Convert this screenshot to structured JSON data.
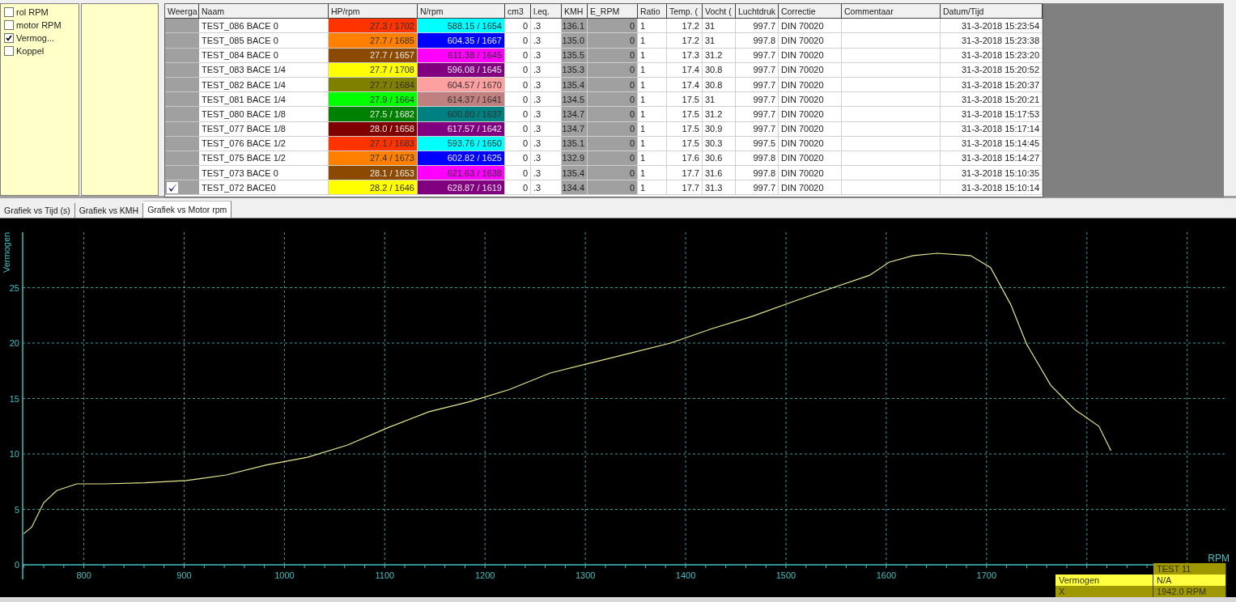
{
  "channels": [
    {
      "label": "rol RPM",
      "checked": false
    },
    {
      "label": "motor RPM",
      "checked": false
    },
    {
      "label": "Vermog...",
      "checked": true
    },
    {
      "label": "Koppel",
      "checked": false
    }
  ],
  "table": {
    "columns": [
      "Weerga",
      "Naam",
      "HP/rpm",
      "N/rpm",
      "cm3",
      "l.eq.",
      "KMH",
      "E_RPM",
      "Ratio",
      "Temp. (",
      "Vocht (",
      "Luchtdruk",
      "Correctie",
      "Commentaar",
      "Datum/Tijd"
    ],
    "rows": [
      {
        "shown": false,
        "name": "TEST_086 BACE 0",
        "hp": {
          "text": "27.3 / 1702",
          "color": "#ff3300"
        },
        "n": {
          "text": "588.15 / 1654",
          "color": "#00ffff"
        },
        "cm3": "0",
        "leq": ".3",
        "kmh": "136.1",
        "e_rpm": "0",
        "ratio": "1",
        "temp": "17.2",
        "vocht": "31",
        "luchtdruk": "997.7",
        "correctie": "DIN 70020",
        "datum": "31-3-2018 15:23:54"
      },
      {
        "shown": false,
        "name": "TEST_085 BACE 0",
        "hp": {
          "text": "27.7 / 1685",
          "color": "#ff8000"
        },
        "n": {
          "text": "604.35 / 1667",
          "color": "#0000ff"
        },
        "cm3": "0",
        "leq": ".3",
        "kmh": "135.0",
        "e_rpm": "0",
        "ratio": "1",
        "temp": "17.2",
        "vocht": "31",
        "luchtdruk": "997.8",
        "correctie": "DIN 70020",
        "datum": "31-3-2018 15:23:38"
      },
      {
        "shown": false,
        "name": "TEST_084 BACE 0",
        "hp": {
          "text": "27.7 / 1657",
          "color": "#8b4a00"
        },
        "n": {
          "text": "611.38 / 1645",
          "color": "#ff00ff"
        },
        "cm3": "0",
        "leq": ".3",
        "kmh": "135.5",
        "e_rpm": "0",
        "ratio": "1",
        "temp": "17.3",
        "vocht": "31.2",
        "luchtdruk": "997.7",
        "correctie": "DIN 70020",
        "datum": "31-3-2018 15:23:20"
      },
      {
        "shown": false,
        "name": "TEST_083 BACE 1/4",
        "hp": {
          "text": "27.7 / 1708",
          "color": "#ffff00"
        },
        "n": {
          "text": "596.08 / 1645",
          "color": "#800080"
        },
        "cm3": "0",
        "leq": ".3",
        "kmh": "135.3",
        "e_rpm": "0",
        "ratio": "1",
        "temp": "17.4",
        "vocht": "30.8",
        "luchtdruk": "997.7",
        "correctie": "DIN 70020",
        "datum": "31-3-2018 15:20:52"
      },
      {
        "shown": false,
        "name": "TEST_082 BACE 1/4",
        "hp": {
          "text": "27.7 / 1684",
          "color": "#808000"
        },
        "n": {
          "text": "604.57 / 1670",
          "color": "#ffa0a0"
        },
        "cm3": "0",
        "leq": ".3",
        "kmh": "135.4",
        "e_rpm": "0",
        "ratio": "1",
        "temp": "17.4",
        "vocht": "30.8",
        "luchtdruk": "997.7",
        "correctie": "DIN 70020",
        "datum": "31-3-2018 15:20:37"
      },
      {
        "shown": false,
        "name": "TEST_081 BACE 1/4",
        "hp": {
          "text": "27.9 / 1664",
          "color": "#00ff00"
        },
        "n": {
          "text": "614.37 / 1641",
          "color": "#c08080"
        },
        "cm3": "0",
        "leq": ".3",
        "kmh": "134.5",
        "e_rpm": "0",
        "ratio": "1",
        "temp": "17.5",
        "vocht": "31",
        "luchtdruk": "997.7",
        "correctie": "DIN 70020",
        "datum": "31-3-2018 15:20:21"
      },
      {
        "shown": false,
        "name": "TEST_080 BACE 1/8",
        "hp": {
          "text": "27.5 / 1682",
          "color": "#008000"
        },
        "n": {
          "text": "600.80 / 1637",
          "color": "#008080"
        },
        "cm3": "0",
        "leq": ".3",
        "kmh": "134.7",
        "e_rpm": "0",
        "ratio": "1",
        "temp": "17.5",
        "vocht": "31.2",
        "luchtdruk": "997.7",
        "correctie": "DIN 70020",
        "datum": "31-3-2018 15:17:53"
      },
      {
        "shown": false,
        "name": "TEST_077 BACE 1/8",
        "hp": {
          "text": "28.0 / 1658",
          "color": "#800000"
        },
        "n": {
          "text": "617.57 / 1642",
          "color": "#800080"
        },
        "cm3": "0",
        "leq": ".3",
        "kmh": "134.7",
        "e_rpm": "0",
        "ratio": "1",
        "temp": "17.5",
        "vocht": "30.9",
        "luchtdruk": "997.7",
        "correctie": "DIN 70020",
        "datum": "31-3-2018 15:17:14"
      },
      {
        "shown": false,
        "name": "TEST_076 BACE 1/2",
        "hp": {
          "text": "27.1 / 1683",
          "color": "#ff3300"
        },
        "n": {
          "text": "593.76 / 1650",
          "color": "#00ffff"
        },
        "cm3": "0",
        "leq": ".3",
        "kmh": "135.1",
        "e_rpm": "0",
        "ratio": "1",
        "temp": "17.5",
        "vocht": "30.3",
        "luchtdruk": "997.5",
        "correctie": "DIN 70020",
        "datum": "31-3-2018 15:14:45"
      },
      {
        "shown": false,
        "name": "TEST_075 BACE 1/2",
        "hp": {
          "text": "27.4 / 1673",
          "color": "#ff8000"
        },
        "n": {
          "text": "602.82 / 1625",
          "color": "#0000ff"
        },
        "cm3": "0",
        "leq": ".3",
        "kmh": "132.9",
        "e_rpm": "0",
        "ratio": "1",
        "temp": "17.6",
        "vocht": "30.6",
        "luchtdruk": "997.8",
        "correctie": "DIN 70020",
        "datum": "31-3-2018 15:14:27"
      },
      {
        "shown": false,
        "name": "TEST_073 BACE 0",
        "hp": {
          "text": "28.1 / 1653",
          "color": "#8b4a00"
        },
        "n": {
          "text": "621.63 / 1638",
          "color": "#ff00ff"
        },
        "cm3": "0",
        "leq": ".3",
        "kmh": "135.4",
        "e_rpm": "0",
        "ratio": "1",
        "temp": "17.7",
        "vocht": "31.6",
        "luchtdruk": "997.8",
        "correctie": "DIN 70020",
        "datum": "31-3-2018 15:10:35"
      },
      {
        "shown": true,
        "name": "TEST_072 BACE0",
        "hp": {
          "text": "28.2 / 1646",
          "color": "#ffff00"
        },
        "n": {
          "text": "628.87 / 1619",
          "color": "#800080"
        },
        "cm3": "0",
        "leq": ".3",
        "kmh": "134.4",
        "e_rpm": "0",
        "ratio": "1",
        "temp": "17.7",
        "vocht": "31.3",
        "luchtdruk": "997.7",
        "correctie": "DIN 70020",
        "datum": "31-3-2018 15:10:14"
      }
    ]
  },
  "tabs": [
    {
      "label": "Grafiek vs Tijd (s)",
      "selected": false
    },
    {
      "label": "Grafiek vs KMH",
      "selected": false
    },
    {
      "label": "Grafiek vs Motor rpm",
      "selected": true
    }
  ],
  "chart": {
    "chart_data": {
      "type": "line",
      "xlabel": "RPM",
      "ylabel": "Vermogen",
      "xlim": [
        739,
        1939
      ],
      "ylim": [
        0,
        30
      ],
      "grid": true,
      "xticks": [
        800,
        900,
        1000,
        1100,
        1200,
        1300,
        1400,
        1500,
        1600,
        1700
      ],
      "yticks": [
        0,
        5,
        10,
        15,
        20,
        25
      ],
      "x": [
        740,
        748,
        760,
        773,
        793,
        821,
        861,
        902,
        942,
        982,
        1023,
        1063,
        1104,
        1144,
        1184,
        1224,
        1265,
        1305,
        1345,
        1385,
        1426,
        1466,
        1506,
        1547,
        1583,
        1603,
        1627,
        1651,
        1684,
        1704,
        1724,
        1740,
        1764,
        1788,
        1812,
        1824
      ],
      "series": [
        {
          "color": "#e8e890",
          "values": [
            2.8,
            3.4,
            5.6,
            6.7,
            7.3,
            7.3,
            7.4,
            7.6,
            8.1,
            9.0,
            9.7,
            10.8,
            12.4,
            13.8,
            14.7,
            15.8,
            17.3,
            18.2,
            19.1,
            20.0,
            21.3,
            22.4,
            23.7,
            25.0,
            26.1,
            27.3,
            27.9,
            28.1,
            27.9,
            26.8,
            23.5,
            19.9,
            16.2,
            14.0,
            12.5,
            10.3
          ]
        }
      ]
    },
    "tooltip": {
      "title": "TEST  11",
      "rows": [
        {
          "label": "Vermogen",
          "value": "N/A",
          "selected": true
        },
        {
          "label": "X",
          "value": "1942.0 RPM",
          "selected": false
        }
      ]
    }
  }
}
